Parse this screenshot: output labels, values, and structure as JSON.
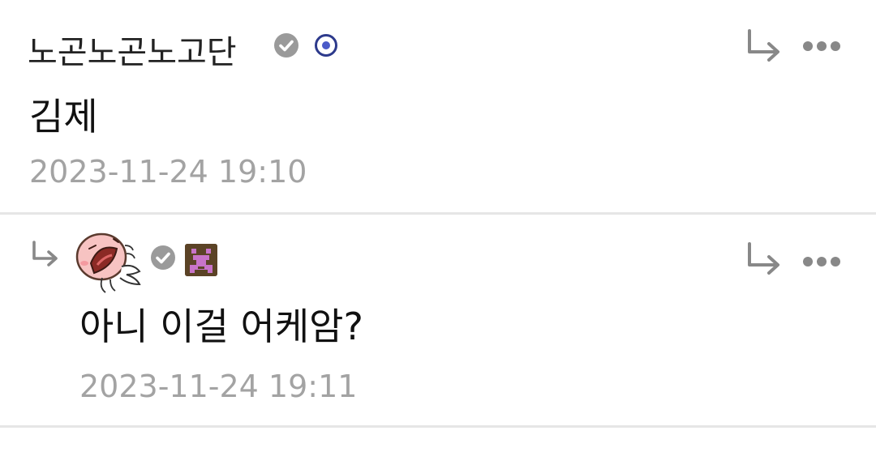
{
  "comments": [
    {
      "author": "노곤노곤노고단",
      "text": "김제",
      "timestamp": "2023-11-24 19:10"
    },
    {
      "author": "",
      "text": "아니 이걸 어케암?",
      "timestamp": "2023-11-24 19:11"
    }
  ],
  "icons": {
    "verified": "check-circle-icon",
    "reply": "reply-arrow-icon",
    "more": "more-dots-icon"
  },
  "colors": {
    "text": "#111111",
    "timestamp": "#a3a3a3",
    "icon": "#888888",
    "divider": "#e6e6e6"
  }
}
